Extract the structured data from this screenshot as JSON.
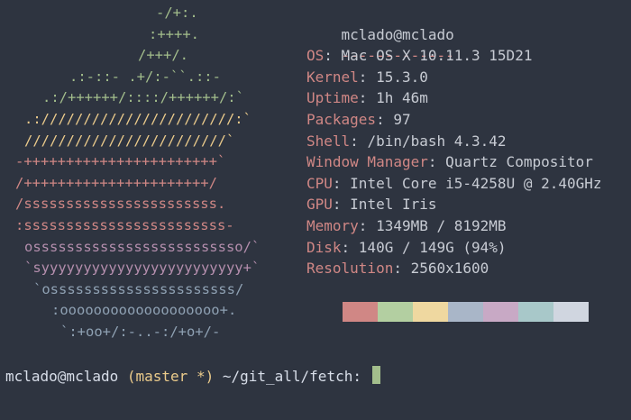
{
  "logo": {
    "lines": [
      {
        "text": "-/+:.",
        "color": "#a3be8c"
      },
      {
        "text": ":++++.",
        "color": "#a3be8c"
      },
      {
        "text": "/+++/.",
        "color": "#a3be8c"
      },
      {
        "text": ".:-::- .+/:-``.::-",
        "color": "#a3be8c"
      },
      {
        "text": ".:/++++++/::::/++++++/:`",
        "color": "#a3be8c"
      },
      {
        "text": ".:///////////////////////:`",
        "color": "#ebcb8b"
      },
      {
        "text": "////////////////////////`",
        "color": "#ebcb8b"
      },
      {
        "text": "-+++++++++++++++++++++++`",
        "color": "#d08785"
      },
      {
        "text": "/++++++++++++++++++++++/",
        "color": "#d08785"
      },
      {
        "text": "/sssssssssssssssssssssss.",
        "color": "#d08785"
      },
      {
        "text": ":ssssssssssssssssssssssss-",
        "color": "#d08785"
      },
      {
        "text": "osssssssssssssssssssssssso/`",
        "color": "#b48ead"
      },
      {
        "text": "`syyyyyyyyyyyyyyyyyyyyyyyy+`",
        "color": "#b48ead"
      },
      {
        "text": "`ossssssssssssssssssssss/",
        "color": "#8fa1b3"
      },
      {
        "text": ":ooooooooooooooooooo+.",
        "color": "#8fa1b3"
      },
      {
        "text": "`:+oo+/:-..-:/+o+/-",
        "color": "#8fa1b3"
      }
    ]
  },
  "info": {
    "host": "mclado@mclado",
    "separator": "-------------",
    "fields": [
      {
        "key": "OS",
        "value": "Mac OS X 10.11.3 15D21"
      },
      {
        "key": "Kernel",
        "value": "15.3.0"
      },
      {
        "key": "Uptime",
        "value": "1h 46m"
      },
      {
        "key": "Packages",
        "value": "97"
      },
      {
        "key": "Shell",
        "value": "/bin/bash 4.3.42"
      },
      {
        "key": "Window Manager",
        "value": "Quartz Compositor"
      },
      {
        "key": "CPU",
        "value": "Intel Core i5-4258U @ 2.40GHz"
      },
      {
        "key": "GPU",
        "value": "Intel Iris"
      },
      {
        "key": "Memory",
        "value": "1349MB / 8192MB"
      },
      {
        "key": "Disk",
        "value": "140G / 149G (94%)"
      },
      {
        "key": "Resolution",
        "value": "2560x1600"
      }
    ],
    "key_separator": ":"
  },
  "palette": [
    "#d08785",
    "#b3cfa1",
    "#efd8a0",
    "#a9b6c8",
    "#c8a9c5",
    "#a8c8c9",
    "#d0d6e0"
  ],
  "prompt": {
    "user_host": "mclado@mclado",
    "branch": "(master *)",
    "path": "~/git_all/fetch:"
  },
  "colors": {
    "background": "#2e3440",
    "key": "#d08785",
    "text": "#c7cbd3",
    "branch": "#ebcb8b",
    "cursor": "#a3be8c"
  }
}
